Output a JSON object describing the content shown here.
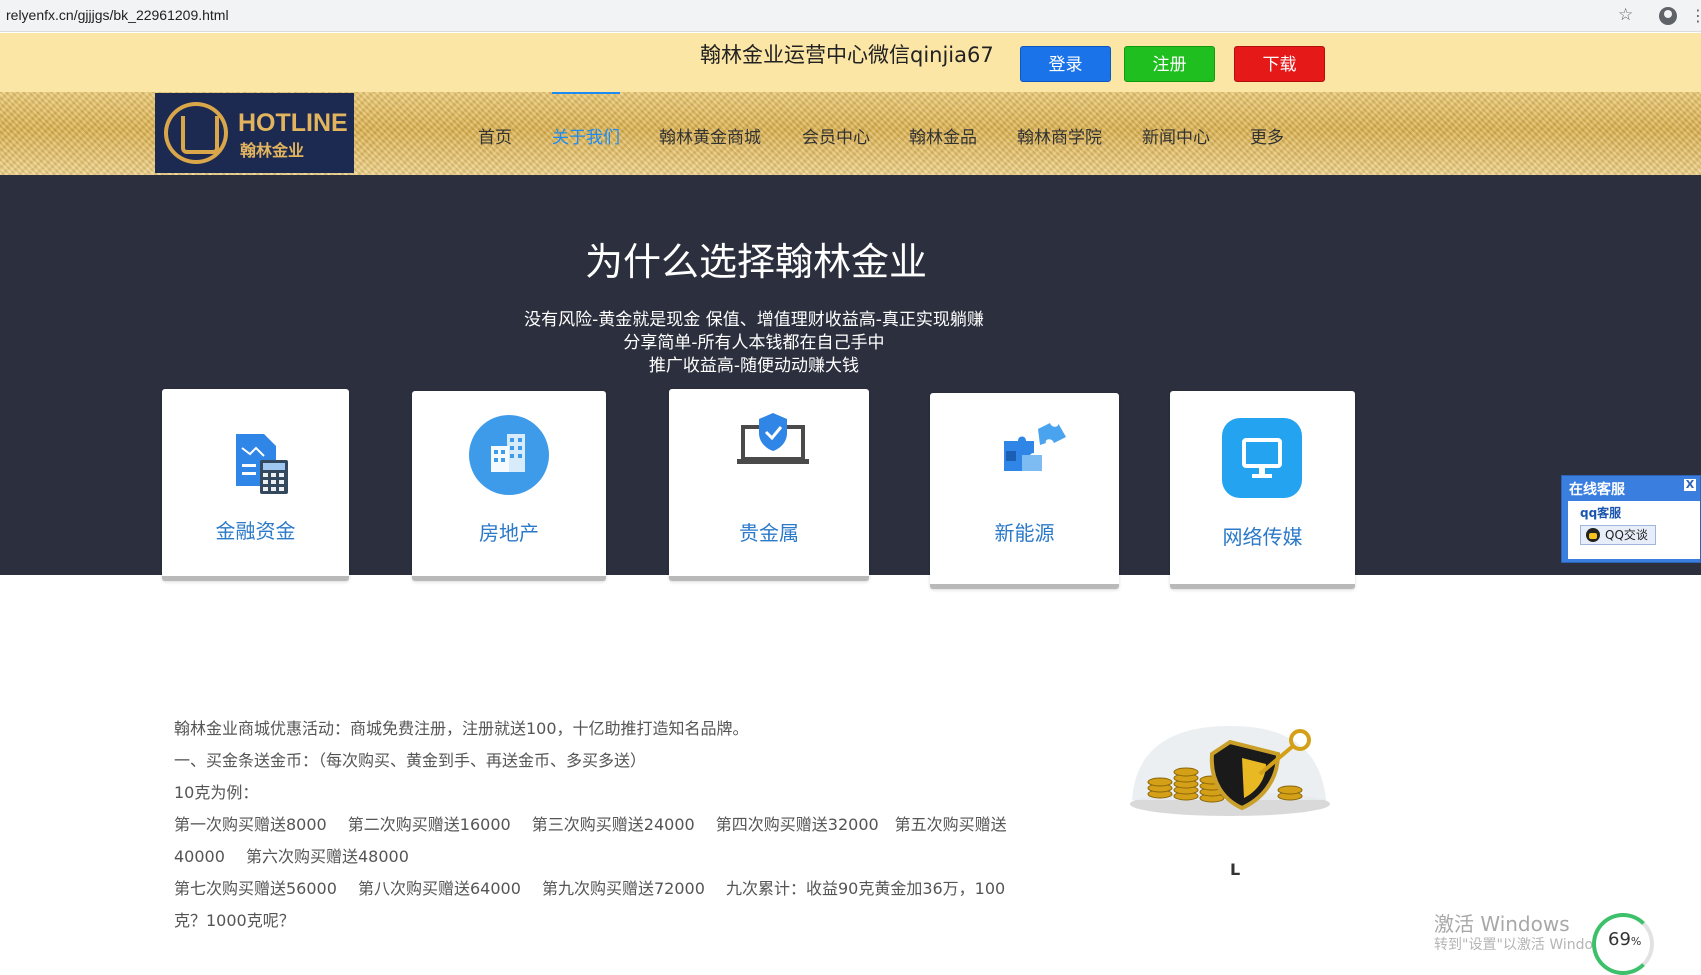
{
  "browser": {
    "url": "relyenfx.cn/gjjjgs/bk_22961209.html"
  },
  "top_strip": {
    "title": "翰林金业运营中心微信qinjia67",
    "login": "登录",
    "register": "注册",
    "download": "下载"
  },
  "logo": {
    "title": "HOTLINE",
    "subtitle": "翰林金业"
  },
  "nav": {
    "items": [
      "首页",
      "关于我们",
      "翰林黄金商城",
      "会员中心",
      "翰林金品",
      "翰林商学院",
      "新闻中心",
      "更多"
    ],
    "active_index": 1,
    "active_color": "#1f8bf0"
  },
  "hero": {
    "title": "为什么选择翰林金业",
    "lines": [
      "没有风险-黄金就是现金 保值、增值理财收益高-真正实现躺赚",
      "分享简单-所有人本钱都在自己手中",
      "推广收益高-随便动动赚大钱"
    ],
    "background": "#2c2f3d"
  },
  "cards": [
    {
      "label": "金融资金",
      "icon": "finance-calculator-icon"
    },
    {
      "label": "房地产",
      "icon": "building-icon"
    },
    {
      "label": "贵金属",
      "icon": "shield-laptop-icon"
    },
    {
      "label": "新能源",
      "icon": "puzzle-icon"
    },
    {
      "label": "网络传媒",
      "icon": "monitor-icon"
    }
  ],
  "service": {
    "header": "在线客服",
    "close": "X",
    "qq_label": "qq客服",
    "qq_button": "QQ交谈"
  },
  "promo": {
    "lines": [
      "翰林金业商城优惠活动：商城免费注册，注册就送100，十亿助推打造知名品牌。",
      "一、买金条送金币：（每次购买、黄金到手、再送金币、多买多送）",
      "10克为例：",
      "第一次购买赠送8000　 第二次购买赠送16000　 第三次购买赠送24000　 第四次购买赠送32000　第五次购买赠送",
      "40000　 第六次购买赠送48000",
      "第七次购买赠送56000　 第八次购买赠送64000　 第九次购买赠送72000　 九次累计：收益90克黄金加36万，100",
      "克？1000克呢？"
    ]
  },
  "image_caption": "L",
  "watermark": {
    "line1": "激活 Windows",
    "line2": "转到\"设置\"以激活 Windows"
  },
  "gauge": {
    "value": "69",
    "unit": "%",
    "percent": 69
  }
}
